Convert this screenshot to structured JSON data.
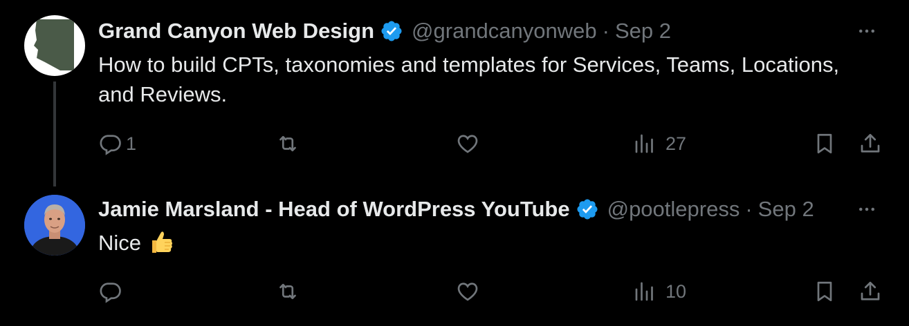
{
  "tweets": [
    {
      "author_name": "Grand Canyon Web Design",
      "handle": "@grandcanyonweb",
      "separator": "·",
      "date": "Sep 2",
      "text": "How to build CPTs, taxonomies and templates for Services, Teams, Locations, and Reviews.",
      "verified": true,
      "avatar_icon": "arizona-map-icon",
      "actions": {
        "replies": "1",
        "retweets": "",
        "likes": "",
        "views": "27"
      }
    },
    {
      "author_name": "Jamie Marsland - Head of WordPress YouTube",
      "handle": "@pootlepress",
      "separator": "·",
      "date": "Sep 2",
      "text": "Nice",
      "emoji": "thumbs-up-icon",
      "verified": true,
      "avatar_icon": "person-portrait-icon",
      "actions": {
        "replies": "",
        "retweets": "",
        "likes": "",
        "views": "10"
      }
    }
  ],
  "colors": {
    "background": "#000000",
    "primary_text": "#e7e9ea",
    "secondary_text": "#71767b",
    "verified_badge": "#1d9bf0",
    "thread_line": "#333639"
  }
}
